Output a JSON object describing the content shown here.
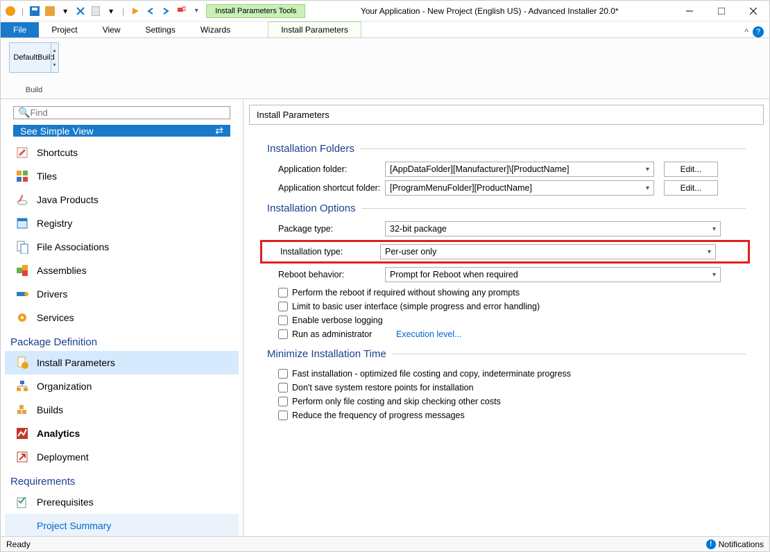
{
  "title": "Your Application - New Project (English US) - Advanced Installer 20.0*",
  "tool_tab": "Install Parameters Tools",
  "tabs": {
    "file": "File",
    "project": "Project",
    "view": "View",
    "settings": "Settings",
    "wizards": "Wizards",
    "install_params": "Install Parameters"
  },
  "ribbon": {
    "default_build": "DefaultBuild",
    "build_label": "Build"
  },
  "search_placeholder": "Find",
  "simple_view": "See Simple View",
  "nav_plain": [
    "Shortcuts",
    "Tiles",
    "Java Products",
    "Registry",
    "File Associations",
    "Assemblies",
    "Drivers",
    "Services"
  ],
  "section_pkg": "Package Definition",
  "nav_pkg": [
    "Install Parameters",
    "Organization",
    "Builds",
    "Analytics",
    "Deployment"
  ],
  "section_req": "Requirements",
  "nav_req": [
    "Prerequisites",
    "Project Summary"
  ],
  "panel_title": "Install Parameters",
  "grp_folders": "Installation Folders",
  "app_folder_lbl": "Application folder:",
  "app_folder_val": "[AppDataFolder][Manufacturer]\\[ProductName]",
  "shortcut_folder_lbl": "Application shortcut folder:",
  "shortcut_folder_val": "[ProgramMenuFolder][ProductName]",
  "edit_btn": "Edit...",
  "grp_options": "Installation Options",
  "pkg_type_lbl": "Package type:",
  "pkg_type_val": "32-bit package",
  "inst_type_lbl": "Installation type:",
  "inst_type_val": "Per-user only",
  "reboot_lbl": "Reboot behavior:",
  "reboot_val": "Prompt for Reboot when required",
  "chk_reboot_silent": "Perform the reboot if required without showing any prompts",
  "chk_basic_ui": "Limit to basic user interface (simple progress and error handling)",
  "chk_verbose": "Enable verbose logging",
  "chk_admin": "Run as administrator",
  "exec_level": "Execution level...",
  "grp_minimize": "Minimize Installation Time",
  "chk_fast": "Fast installation - optimized file costing and copy, indeterminate progress",
  "chk_restore": "Don't save system restore points for installation",
  "chk_costing": "Perform only file costing and skip checking other costs",
  "chk_freq": "Reduce the frequency of progress messages",
  "status_left": "Ready",
  "status_notif": "Notifications"
}
